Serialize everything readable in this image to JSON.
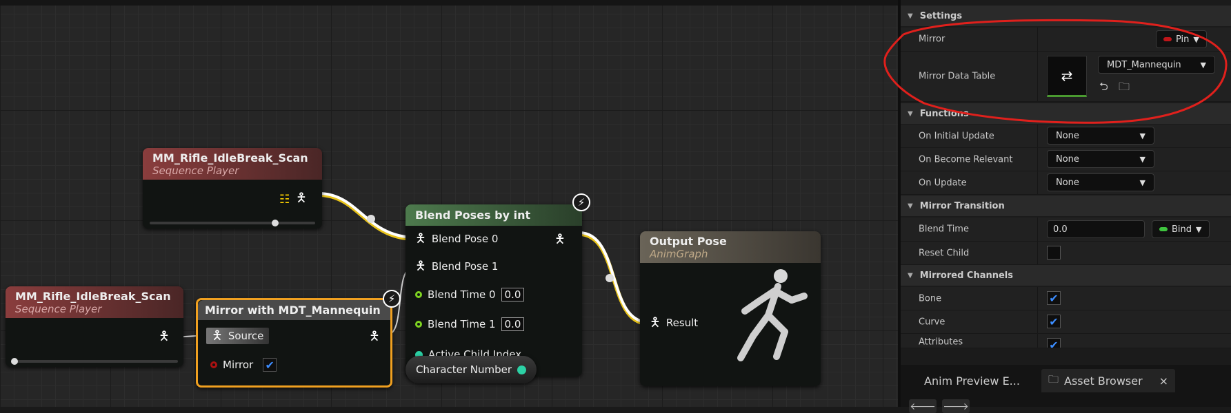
{
  "graph": {
    "seq1": {
      "title": "MM_Rifle_IdleBreak_Scan",
      "subtitle": "Sequence Player",
      "slider": 0.76
    },
    "seq2": {
      "title": "MM_Rifle_IdleBreak_Scan",
      "subtitle": "Sequence Player",
      "slider": 0.0
    },
    "mirror_node": {
      "title": "Mirror with MDT_Mannequin",
      "source_label": "Source",
      "mirror_label": "Mirror",
      "mirror_checked": true
    },
    "blend_node": {
      "title": "Blend Poses by int",
      "pose0": "Blend Pose 0",
      "pose1": "Blend Pose 1",
      "time0": "Blend Time 0",
      "time0_val": "0.0",
      "time1": "Blend Time 1",
      "time1_val": "0.0",
      "active": "Active Child Index"
    },
    "char_node": {
      "label": "Character Number"
    },
    "output_node": {
      "title": "Output Pose",
      "subtitle": "AnimGraph",
      "result": "Result"
    }
  },
  "panel": {
    "settings": {
      "header": "Settings",
      "mirror_label": "Mirror",
      "mirror_value": "Pin",
      "mirror_color": "#c0161a",
      "mdt_label": "Mirror Data Table",
      "mdt_value": "MDT_Mannequin"
    },
    "functions": {
      "header": "Functions",
      "rows": [
        {
          "label": "On Initial Update",
          "value": "None"
        },
        {
          "label": "On Become Relevant",
          "value": "None"
        },
        {
          "label": "On Update",
          "value": "None"
        }
      ]
    },
    "mirror_transition": {
      "header": "Mirror Transition",
      "blend_time_label": "Blend Time",
      "blend_time_value": "0.0",
      "bind_label": "Bind",
      "bind_color": "#3fc53f",
      "reset_child_label": "Reset Child"
    },
    "mirrored_channels": {
      "header": "Mirrored Channels",
      "bone": "Bone",
      "curve": "Curve",
      "attributes": "Attributes"
    },
    "tabs": {
      "tab1": "Anim Preview E...",
      "tab2": "Asset Browser",
      "close": "×"
    }
  },
  "annotation_color": "#e0201c"
}
